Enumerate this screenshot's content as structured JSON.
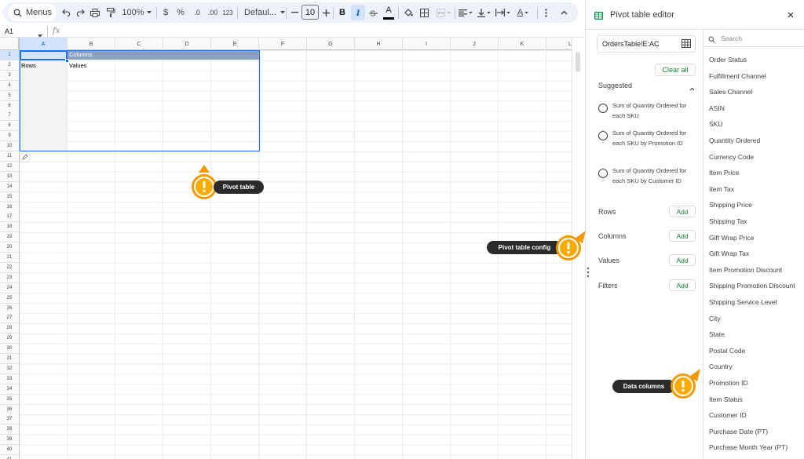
{
  "toolbar": {
    "menus_label": "Menus",
    "zoom": "100%",
    "currency": "$",
    "percent": "%",
    "decrease_decimal": ".0",
    "increase_decimal": ".00",
    "number_format": "123",
    "font": "Defaul...",
    "font_size": "10",
    "bold": "B",
    "italic": "I",
    "text_color_letter": "A",
    "text_color_letter_2": "A"
  },
  "formula_bar": {
    "cell_ref": "A1",
    "fx": "fx"
  },
  "grid": {
    "columns": [
      "A",
      "B",
      "C",
      "D",
      "E",
      "F",
      "G",
      "H",
      "I",
      "J",
      "K",
      "L"
    ],
    "rows": [
      "1",
      "2",
      "3",
      "4",
      "5",
      "6",
      "7",
      "8",
      "9",
      "10",
      "11",
      "12",
      "13",
      "14",
      "15",
      "16",
      "17",
      "18",
      "19",
      "20",
      "21",
      "22",
      "23",
      "24",
      "25",
      "26",
      "27",
      "28",
      "29",
      "30",
      "31",
      "32",
      "33",
      "34",
      "35",
      "36",
      "37",
      "38",
      "39",
      "40",
      "41"
    ],
    "cells": {
      "b1": "Columns",
      "a2": "Rows",
      "b2": "Values"
    }
  },
  "editor": {
    "title": "Pivot table editor",
    "range": "OrdersTable!E:AC",
    "clear_all": "Clear all",
    "suggested_label": "Suggested",
    "suggestions": [
      "Sum of Quantity Ordered for each SKU",
      "Sum of Quantity Ordered for each SKU by Promotion ID",
      "Sum of Quantity Ordered for each SKU by Customer ID"
    ],
    "sections": [
      {
        "label": "Rows",
        "action": "Add"
      },
      {
        "label": "Columns",
        "action": "Add"
      },
      {
        "label": "Values",
        "action": "Add"
      },
      {
        "label": "Filters",
        "action": "Add"
      }
    ],
    "search_placeholder": "Search",
    "fields": [
      "Order Status",
      "Fulfillment Channel",
      "Sales Channel",
      "ASIN",
      "SKU",
      "Quantity Ordered",
      "Currency Code",
      "Item Price",
      "Item Tax",
      "Shipping Price",
      "Shipping Tax",
      "Gift Wrap Price",
      "Gift Wrap Tax",
      "Item Promotion Discount",
      "Shipping Promotion Discount",
      "Shipping Service Level",
      "City",
      "State",
      "Postal Code",
      "Country",
      "Promotion ID",
      "Item Status",
      "Customer ID",
      "Purchase Date (PT)",
      "Purchase Month Year (PT)"
    ]
  },
  "callouts": {
    "pivot_table": "Pivot table",
    "pivot_config": "Pivot table config",
    "data_columns": "Data columns",
    "accent_color": "#f29900",
    "badge_fill": "#f9ab00"
  },
  "colors": {
    "selection_blue": "#1a73e8",
    "pivot_header": "#8ba0c0",
    "add_green": "#188038",
    "sheets_green": "#0f9d58"
  }
}
